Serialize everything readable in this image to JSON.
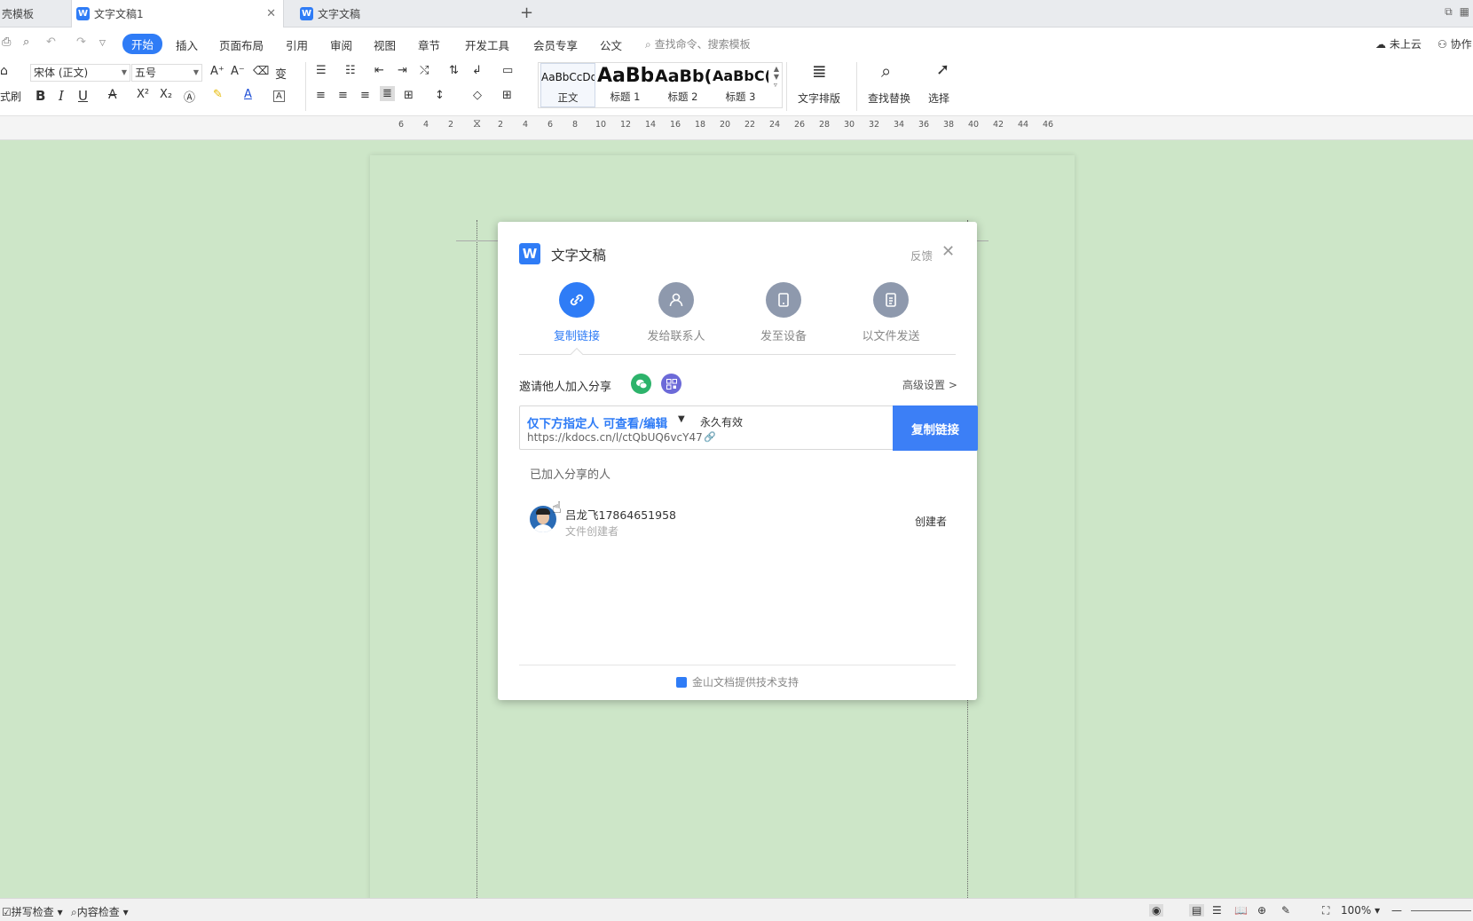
{
  "tabs": [
    {
      "label": "壳模板",
      "active": false
    },
    {
      "label": "文字文稿1",
      "active": true
    },
    {
      "label": "文字文稿",
      "active": false
    }
  ],
  "menubar": {
    "items": [
      "开始",
      "插入",
      "页面布局",
      "引用",
      "审阅",
      "视图",
      "章节",
      "开发工具",
      "会员专享",
      "公文"
    ],
    "active": "开始",
    "search_placeholder": "查找命令、搜索模板",
    "cloud_status": "未上云",
    "collab": "协作"
  },
  "ribbon": {
    "format_painter": "式刷",
    "font_name": "宋体 (正文)",
    "font_size": "五号",
    "styles": [
      {
        "preview": "AaBbCcDd",
        "label": "正文"
      },
      {
        "preview": "AaBb",
        "label": "标题 1"
      },
      {
        "preview": "AaBb(",
        "label": "标题 2"
      },
      {
        "preview": "AaBbC(",
        "label": "标题 3"
      }
    ],
    "text_layout": "文字排版",
    "find_replace": "查找替换",
    "select": "选择"
  },
  "ruler": {
    "numbers": [
      "6",
      "4",
      "2",
      "2",
      "4",
      "6",
      "8",
      "10",
      "12",
      "14",
      "16",
      "18",
      "20",
      "22",
      "24",
      "26",
      "28",
      "30",
      "32",
      "34",
      "36",
      "38",
      "40",
      "42",
      "44",
      "46"
    ]
  },
  "dialog": {
    "title": "文字文稿",
    "feedback": "反馈",
    "options": [
      {
        "label": "复制链接",
        "icon": "link-icon",
        "active": true
      },
      {
        "label": "发给联系人",
        "icon": "person-icon",
        "active": false
      },
      {
        "label": "发至设备",
        "icon": "device-icon",
        "active": false
      },
      {
        "label": "以文件发送",
        "icon": "file-icon",
        "active": false
      }
    ],
    "invite_label": "邀请他人加入分享",
    "advanced": "高级设置 >",
    "permission": "仅下方指定人 可查看/编辑",
    "validity": "永久有效",
    "url": "https://kdocs.cn/l/ctQbUQ6vcY47",
    "copy_button": "复制链接",
    "joined_label": "已加入分享的人",
    "member": {
      "name": "吕龙飞17864651958",
      "role": "文件创建者",
      "tag": "创建者"
    },
    "footer": "金山文档提供技术支持"
  },
  "statusbar": {
    "spell_check": "拼写检查",
    "content_check": "内容检查",
    "zoom": "100%"
  },
  "colors": {
    "accent": "#2f7cf6",
    "page_bg": "#cde6c8"
  }
}
